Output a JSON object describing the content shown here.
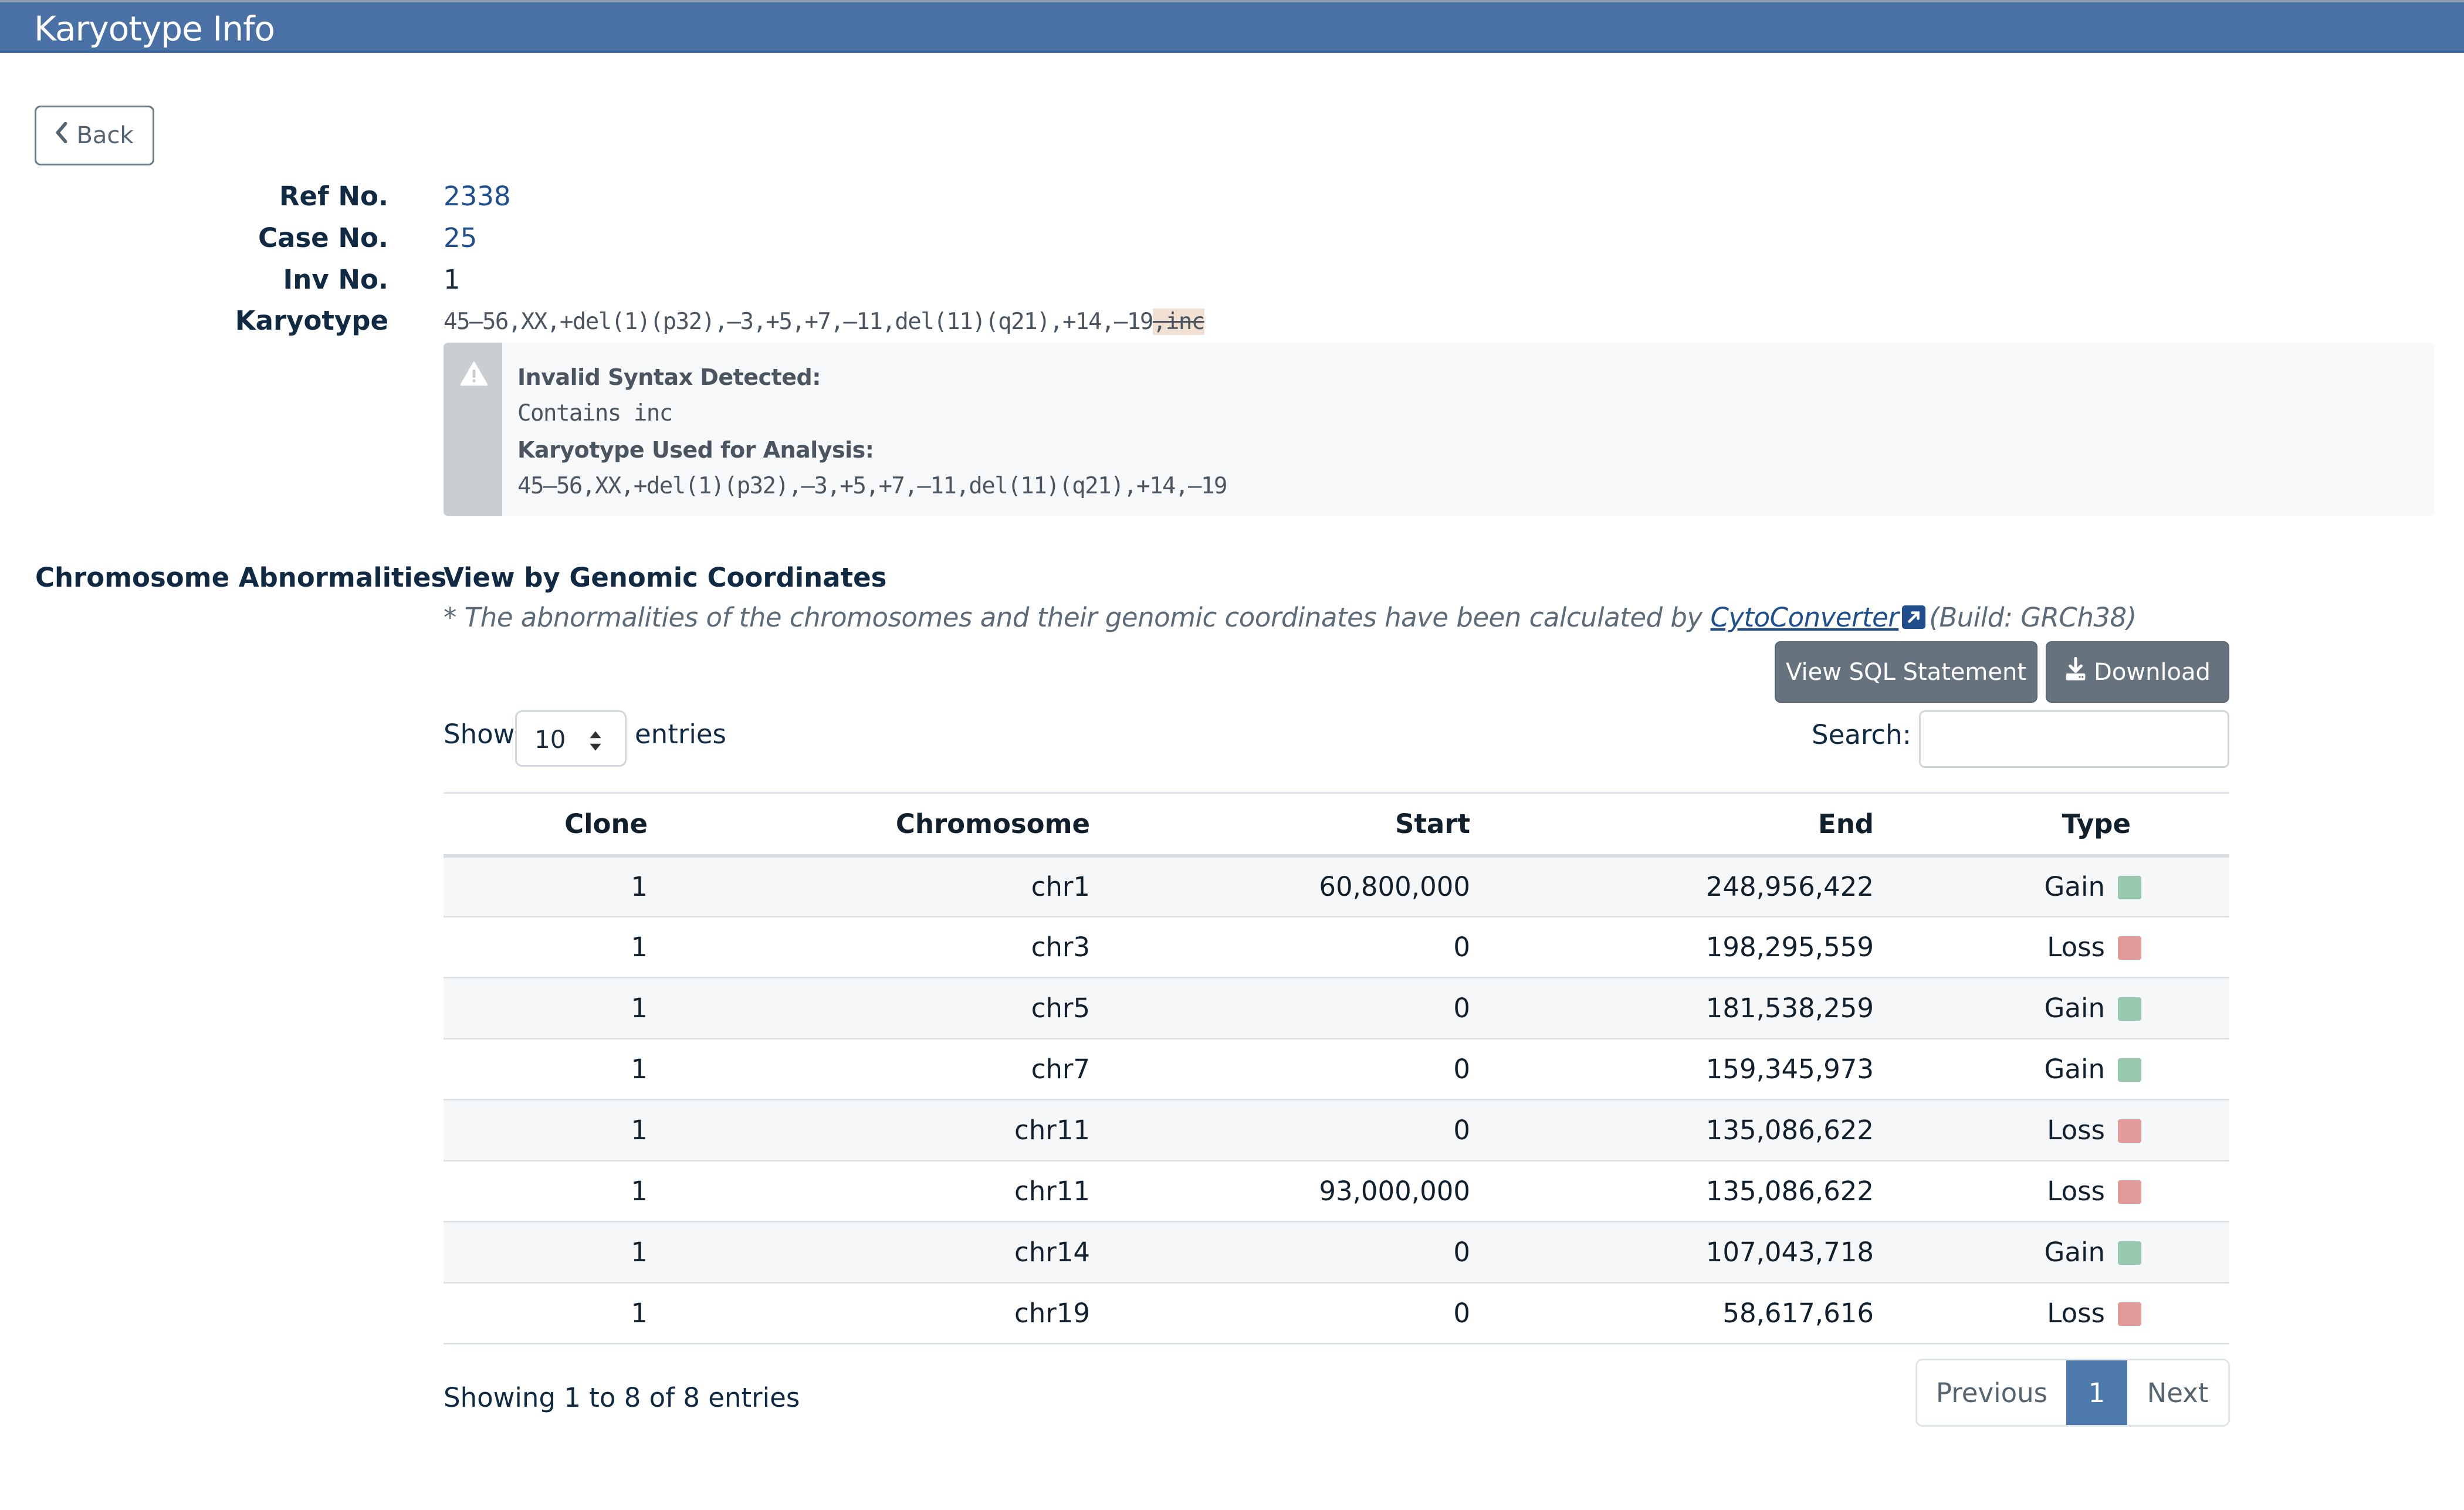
{
  "header": {
    "title": "Karyotype Info"
  },
  "back_button": {
    "label": "Back",
    "icon": "chevron-left-icon"
  },
  "fields": {
    "ref_no": {
      "label": "Ref No.",
      "value": "2338"
    },
    "case_no": {
      "label": "Case No.",
      "value": "25"
    },
    "inv_no": {
      "label": "Inv No.",
      "value": "1"
    },
    "karyotype": {
      "label": "Karyotype",
      "valid_part": "45–56,XX,+del(1)(p32),–3,+5,+7,–11,del(11)(q21),+14,–19",
      "invalid_part": ",inc"
    }
  },
  "warning": {
    "icon": "warning-triangle-icon",
    "heading": "Invalid Syntax Detected:",
    "detail": "Contains inc",
    "analysis_heading": "Karyotype Used for Analysis:",
    "analysis_karyotype": "45–56,XX,+del(1)(p32),–3,+5,+7,–11,del(11)(q21),+14,–19"
  },
  "abnormalities": {
    "section_label": "Chromosome Abnormalities",
    "title": "View by Genomic Coordinates",
    "note_prefix": "* The abnormalities of the chromosomes and their genomic coordinates have been calculated by",
    "note_link": "CytoConverter",
    "note_suffix": "(Build: GRCh38)",
    "buttons": {
      "sql": "View SQL Statement",
      "download": "Download"
    },
    "length_menu": {
      "show": "Show",
      "value": "10",
      "entries": "entries"
    },
    "search": {
      "label": "Search:",
      "value": "",
      "placeholder": ""
    },
    "colors": {
      "gain": "#95c8ae",
      "loss": "#e39a9a",
      "accent": "#4e79ad"
    },
    "table": {
      "columns": [
        "Clone",
        "Chromosome",
        "Start",
        "End",
        "Type"
      ],
      "rows": [
        {
          "clone": "1",
          "chromosome": "chr1",
          "start": "60,800,000",
          "end": "248,956,422",
          "type": "Gain"
        },
        {
          "clone": "1",
          "chromosome": "chr3",
          "start": "0",
          "end": "198,295,559",
          "type": "Loss"
        },
        {
          "clone": "1",
          "chromosome": "chr5",
          "start": "0",
          "end": "181,538,259",
          "type": "Gain"
        },
        {
          "clone": "1",
          "chromosome": "chr7",
          "start": "0",
          "end": "159,345,973",
          "type": "Gain"
        },
        {
          "clone": "1",
          "chromosome": "chr11",
          "start": "0",
          "end": "135,086,622",
          "type": "Loss"
        },
        {
          "clone": "1",
          "chromosome": "chr11",
          "start": "93,000,000",
          "end": "135,086,622",
          "type": "Loss"
        },
        {
          "clone": "1",
          "chromosome": "chr14",
          "start": "0",
          "end": "107,043,718",
          "type": "Gain"
        },
        {
          "clone": "1",
          "chromosome": "chr19",
          "start": "0",
          "end": "58,617,616",
          "type": "Loss"
        }
      ]
    },
    "info": "Showing 1 to 8 of 8 entries",
    "pagination": {
      "previous": "Previous",
      "current": "1",
      "next": "Next"
    }
  }
}
